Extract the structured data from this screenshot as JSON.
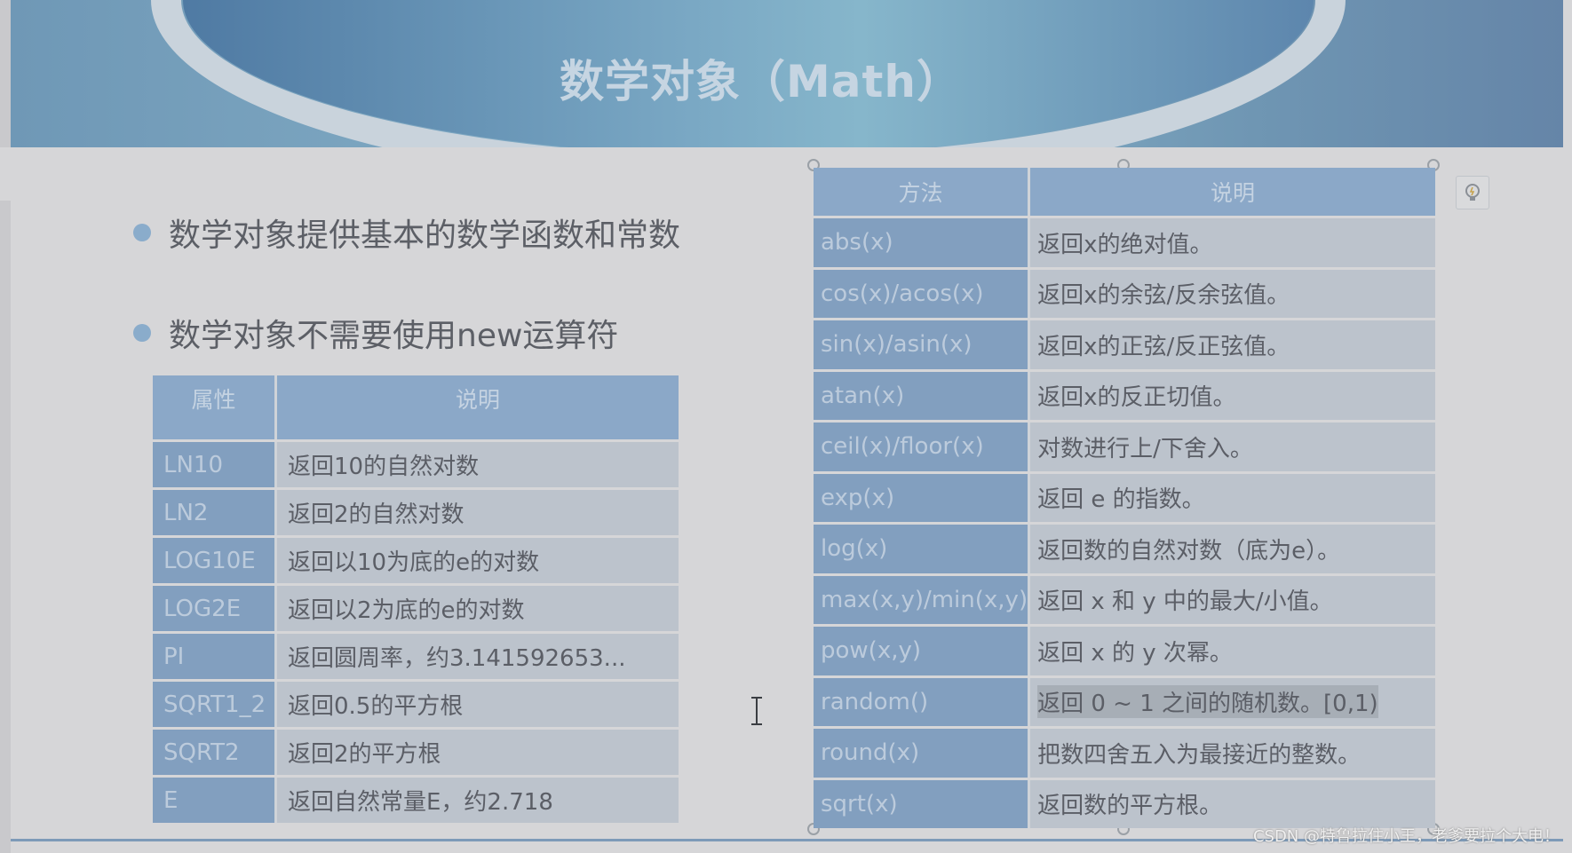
{
  "slide": {
    "title": "数学对象（Math）",
    "bullets": [
      "数学对象提供基本的数学函数和常数",
      "数学对象不需要使用new运算符"
    ]
  },
  "properties_table": {
    "headers": [
      "属性",
      "说明"
    ],
    "rows": [
      [
        "LN10",
        "返回10的自然对数"
      ],
      [
        "LN2",
        "返回2的自然对数"
      ],
      [
        "LOG10E",
        "返回以10为底的e的对数"
      ],
      [
        "LOG2E",
        "返回以2为底的e的对数"
      ],
      [
        "PI",
        "返回圆周率，约3.141592653..."
      ],
      [
        "SQRT1_2",
        "返回0.5的平方根"
      ],
      [
        "SQRT2",
        "返回2的平方根"
      ],
      [
        "E",
        "返回自然常量E，约2.718"
      ]
    ]
  },
  "methods_table": {
    "headers": [
      "方法",
      "说明"
    ],
    "rows": [
      [
        "abs(x)",
        "返回x的绝对值。"
      ],
      [
        "cos(x)/acos(x)",
        "返回x的余弦/反余弦值。"
      ],
      [
        "sin(x)/asin(x)",
        "返回x的正弦/反正弦值。"
      ],
      [
        "atan(x)",
        "返回x的反正切值。"
      ],
      [
        "ceil(x)/floor(x)",
        "对数进行上/下舍入。"
      ],
      [
        "exp(x)",
        "返回 e 的指数。"
      ],
      [
        "log(x)",
        "返回数的自然对数（底为e）。"
      ],
      [
        "max(x,y)/min(x,y)",
        "返回 x 和 y 中的最大/小值。"
      ],
      [
        "pow(x,y)",
        "返回 x 的 y 次幂。"
      ],
      [
        "random()",
        "返回 0 ~ 1 之间的随机数。[0,1)"
      ],
      [
        "round(x)",
        "把数四舍五入为最接近的整数。"
      ],
      [
        "sqrt(x)",
        "返回数的平方根。"
      ]
    ]
  },
  "watermark": "CSDN @特鲁拉住小王，老爹要拉个大电！",
  "icons": {
    "design_ideas": "lightbulb-icon",
    "cursor": "text-cursor-icon"
  }
}
